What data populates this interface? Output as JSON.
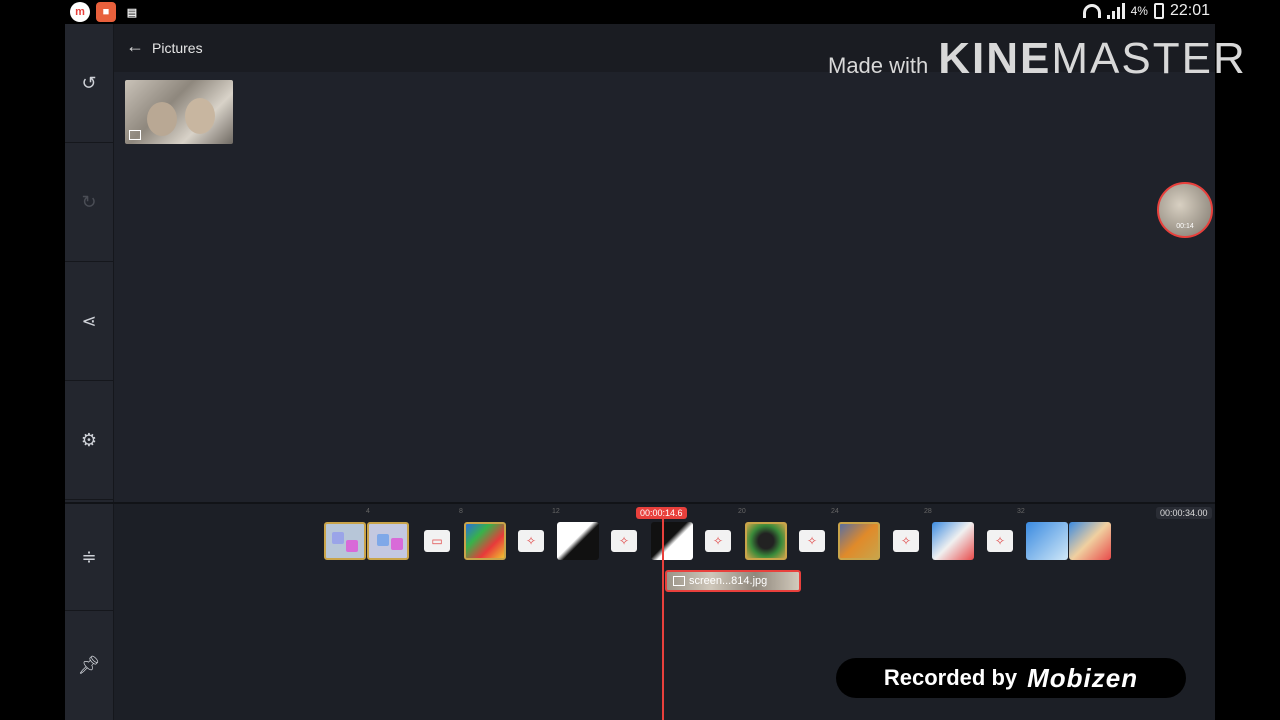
{
  "status_bar": {
    "left_icons": [
      "mobizen-icon",
      "record-icon",
      "clipboard-icon"
    ],
    "battery": "4%",
    "time": "22:01"
  },
  "browser": {
    "breadcrumb": "Pictures"
  },
  "timeline": {
    "playhead_time": "00:00:14.6",
    "end_time": "00:00:34.00",
    "ticks": [
      "4",
      "8",
      "12",
      "20",
      "24",
      "28",
      "32"
    ],
    "layer_clip_label": "screen...814.jpg"
  },
  "overlay": {
    "made_with": "Made with",
    "brand_kine": "KINE",
    "brand_master": "MASTER",
    "bubble_time": "00:14",
    "recorded_by": "Recorded by",
    "recorder_brand": "Mobizen"
  },
  "colors": {
    "accent": "#e8403c",
    "panel": "#1e2129"
  }
}
